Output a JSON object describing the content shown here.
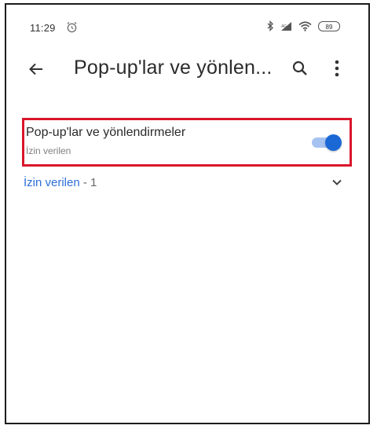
{
  "status_bar": {
    "time": "11:29",
    "battery": "89",
    "icons": [
      "alarm-icon",
      "bluetooth-icon",
      "signal-icon",
      "wifi-icon",
      "battery-icon"
    ]
  },
  "app_bar": {
    "title": "Pop-up'lar ve yönlen...",
    "icons": [
      "back-arrow-icon",
      "search-icon",
      "more-vert-icon"
    ]
  },
  "setting": {
    "title": "Pop-up'lar ve yönlendirmeler",
    "subtitle": "İzin verilen",
    "toggle_on": true
  },
  "allowed_section": {
    "label": "İzin verilen",
    "count": "- 1"
  },
  "colors": {
    "accent": "#1a68d6",
    "toggle_track": "#a6c2f0",
    "highlight_border": "#d9162b",
    "link": "#2e6fd6"
  }
}
